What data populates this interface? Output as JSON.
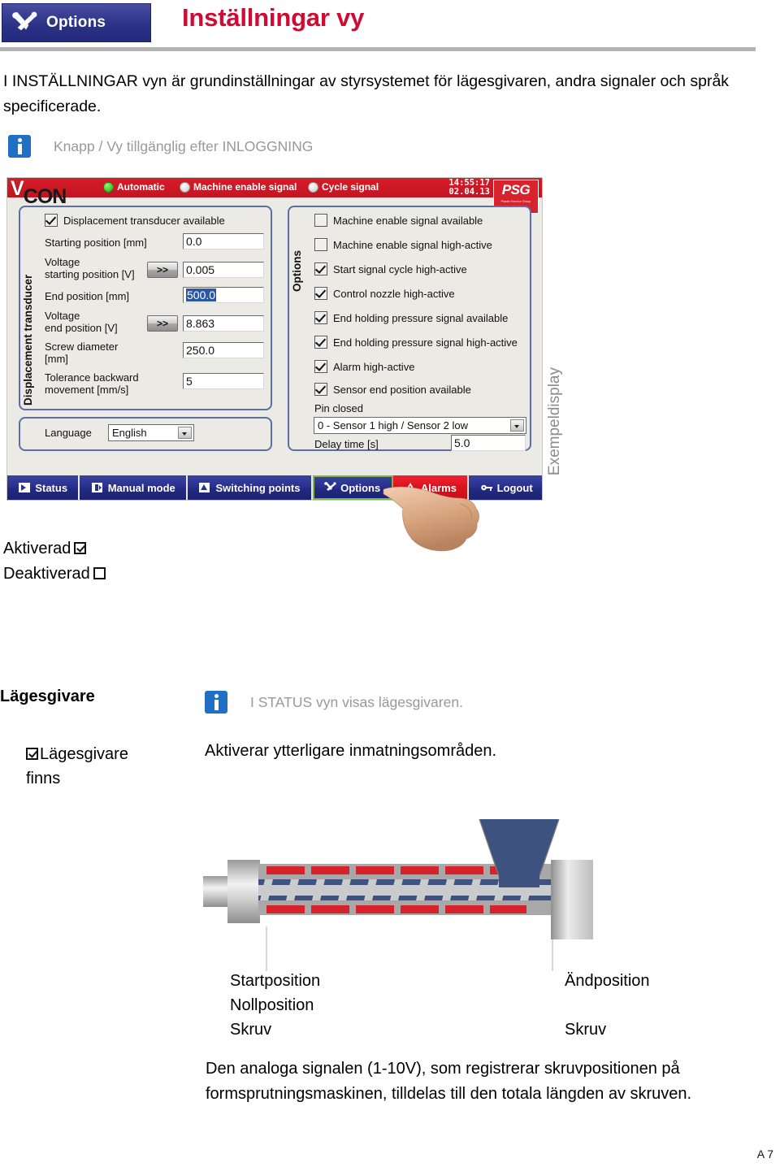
{
  "header": {
    "button_label": "Options",
    "title": "Inställningar vy"
  },
  "intro": "I INSTÄLLNINGAR vyn är grundinställningar av styrsystemet för lägesgivaren, andra signaler och språk specificerade.",
  "notes": {
    "login": "Knapp / Vy tillgänglig efter INLOGGNING",
    "status": "I STATUS vyn visas lägesgivaren."
  },
  "app": {
    "logo": "VCON",
    "logo_v": "V",
    "logo_con": "CON",
    "status_items": [
      {
        "label": "Automatic",
        "led": "green"
      },
      {
        "label": "Machine enable signal",
        "led": "white"
      },
      {
        "label": "Cycle signal",
        "led": "white"
      }
    ],
    "clock_time": "14:55:17",
    "clock_date": "02.04.13",
    "brand": {
      "name": "PSG",
      "tagline": "Plastic Service Group"
    },
    "left_group_label": "Displacement transducer",
    "right_group_label": "Options",
    "left_checkbox": {
      "label": "Displacement transducer available",
      "checked": true
    },
    "fields": [
      {
        "label": "Starting position [mm]",
        "value": "0.0",
        "has_button": false,
        "selected": false
      },
      {
        "label": "Voltage\nstarting position [V]",
        "value": "0.005",
        "has_button": true,
        "button": ">>",
        "selected": false
      },
      {
        "label": "End position [mm]",
        "value": "500.0",
        "has_button": false,
        "selected": true
      },
      {
        "label": "Voltage\nend position [V]",
        "value": "8.863",
        "has_button": true,
        "button": ">>",
        "selected": false
      },
      {
        "label": "Screw diameter\n[mm]",
        "value": "250.0",
        "has_button": false,
        "selected": false
      },
      {
        "label": "Tolerance backward\nmovement [mm/s]",
        "value": "5",
        "has_button": false,
        "selected": false
      }
    ],
    "language_label": "Language",
    "language_value": "English",
    "options": [
      {
        "label": "Machine enable signal available",
        "checked": false
      },
      {
        "label": "Machine enable signal high-active",
        "checked": false
      },
      {
        "label": "Start signal cycle high-active",
        "checked": true
      },
      {
        "label": "Control nozzle high-active",
        "checked": true
      },
      {
        "label": "End holding pressure signal available",
        "checked": true
      },
      {
        "label": "End holding pressure signal high-active",
        "checked": true
      },
      {
        "label": "Alarm high-active",
        "checked": true
      },
      {
        "label": "Sensor end position available",
        "checked": true
      }
    ],
    "pin_label": "Pin closed",
    "pin_value": "0 - Sensor 1 high / Sensor 2 low",
    "delay_label": "Delay time [s]",
    "delay_value": "5.0",
    "toolbar": [
      {
        "label": "Status",
        "icon": "play-icon",
        "state": "normal"
      },
      {
        "label": "Manual mode",
        "icon": "hand-switch-icon",
        "state": "normal"
      },
      {
        "label": "Switching points",
        "icon": "switch-icon",
        "state": "normal"
      },
      {
        "label": "Options",
        "icon": "tools-icon",
        "state": "active"
      },
      {
        "label": "Alarms",
        "icon": "warning-icon",
        "state": "alarm"
      },
      {
        "label": "Logout",
        "icon": "key-icon",
        "state": "normal"
      }
    ],
    "caption": "Exempeldisplay"
  },
  "states": {
    "enabled_label": "Aktiverad",
    "disabled_label": "Deaktiverad",
    "enabled_checked": true,
    "disabled_checked": false
  },
  "section": {
    "title": "Lägesgivare",
    "option_label_line1": "Lägesgivare",
    "option_label_line2": "finns",
    "option_checked": true,
    "option_description": "Aktiverar ytterligare inmatningsområden."
  },
  "diagram": {
    "captions_left": [
      "Startposition",
      "Nollposition",
      "Skruv"
    ],
    "captions_right": [
      "Ändposition",
      "Skruv"
    ],
    "colors": {
      "barrel_grey": "#a8a8a8",
      "heater_red": "#d6232b",
      "melt_blue": "#3e5280",
      "screw_grey": "#c9cbcd",
      "hopper_blue": "#3e5280"
    }
  },
  "bottom_text": "Den analoga signalen (1-10V), som registrerar skruvpositionen på formsprutningsmaskinen, tilldelas till den totala längden av skruven.",
  "page_number": "A 7"
}
